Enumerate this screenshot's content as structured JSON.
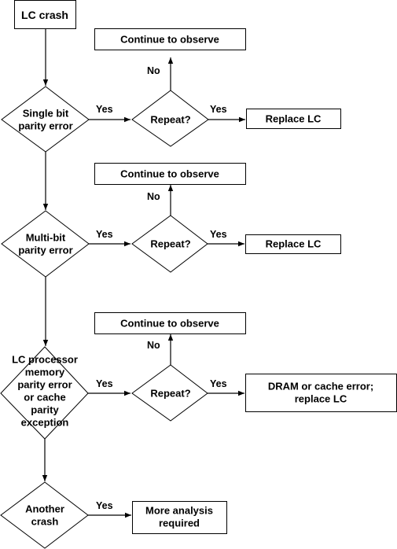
{
  "nodes": {
    "start": {
      "lines": [
        "LC crash"
      ]
    },
    "d1": {
      "lines": [
        "Single bit",
        "parity error"
      ]
    },
    "r1": {
      "lines": [
        "Repeat?"
      ]
    },
    "c1": {
      "lines": [
        "Continue to observe"
      ]
    },
    "a1": {
      "lines": [
        "Replace LC"
      ]
    },
    "d2": {
      "lines": [
        "Multi-bit",
        "parity error"
      ]
    },
    "r2": {
      "lines": [
        "Repeat?"
      ]
    },
    "c2": {
      "lines": [
        "Continue to observe"
      ]
    },
    "a2": {
      "lines": [
        "Replace LC"
      ]
    },
    "d3": {
      "lines": [
        "LC processor",
        "memory",
        "parity error",
        "or cache",
        "parity",
        "exception"
      ]
    },
    "r3": {
      "lines": [
        "Repeat?"
      ]
    },
    "c3": {
      "lines": [
        "Continue to observe"
      ]
    },
    "a3": {
      "lines": [
        "DRAM or cache error;",
        "replace LC"
      ]
    },
    "d4": {
      "lines": [
        "Another",
        "crash"
      ]
    },
    "a4": {
      "lines": [
        "More analysis",
        "required"
      ]
    }
  },
  "edge_labels": {
    "yes": "Yes",
    "no": "No"
  }
}
